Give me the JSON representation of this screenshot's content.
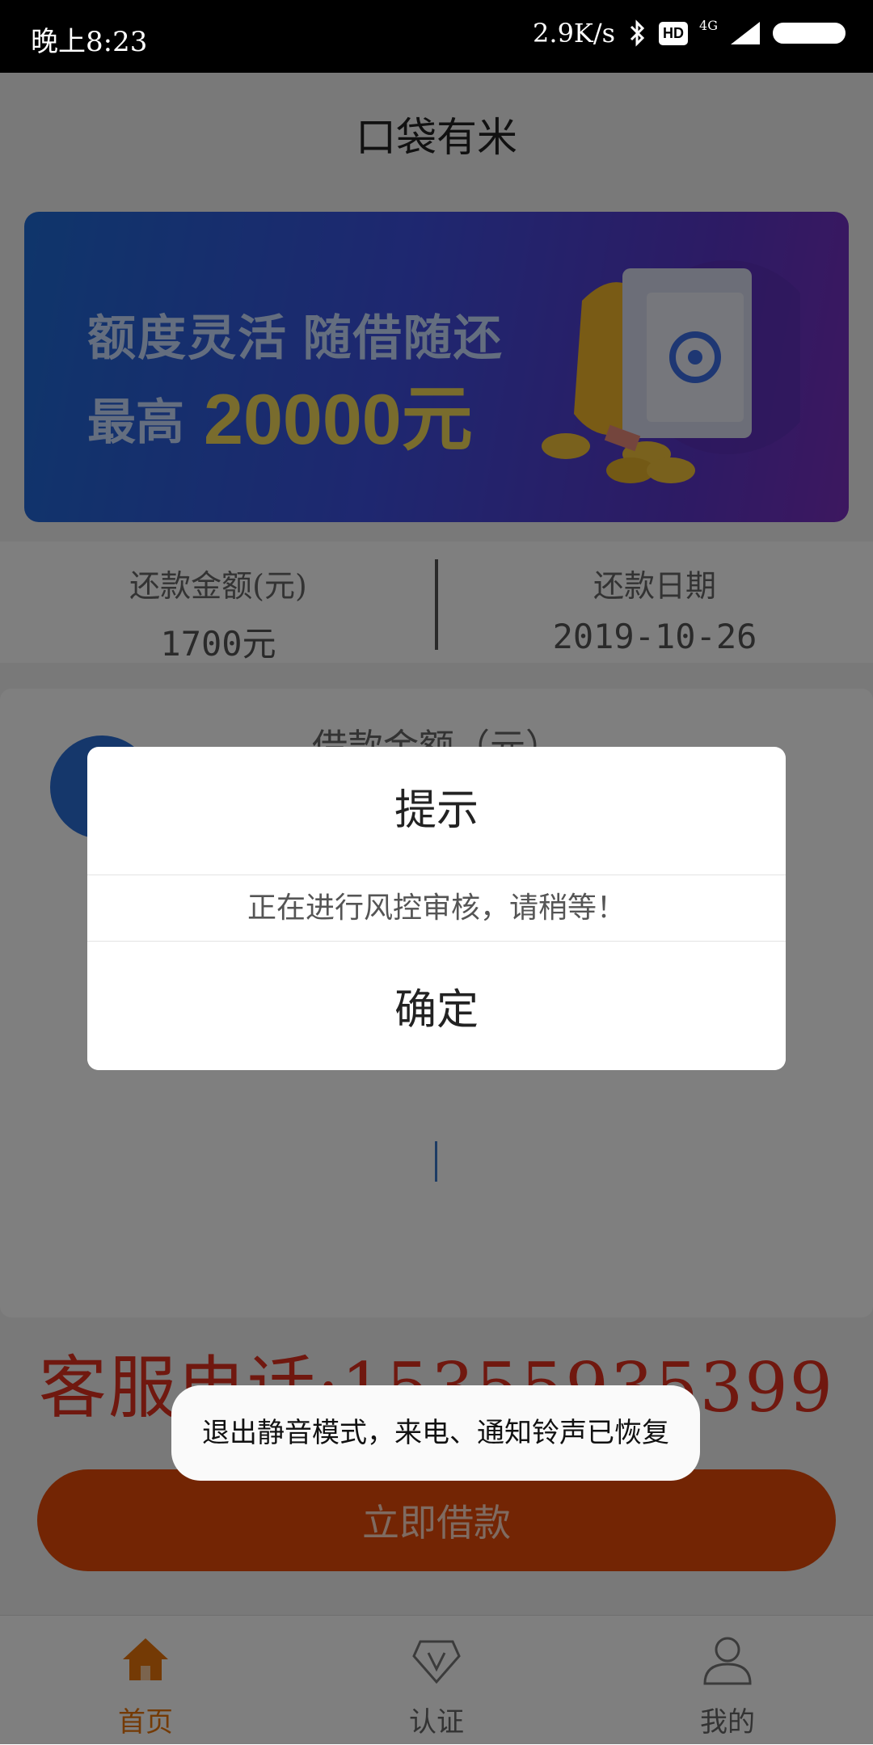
{
  "status_bar": {
    "time": "晚上8:23",
    "speed": "2.9K/s",
    "hd": "HD",
    "network": "4G",
    "icons": [
      "bluetooth-icon",
      "hd-icon",
      "signal-icon",
      "battery-icon"
    ]
  },
  "header": {
    "title": "口袋有米"
  },
  "banner": {
    "line1": "额度灵活 随借随还",
    "line2_prefix": "最高",
    "line2_amount": "20000元",
    "colors": {
      "gradient_start": "#1e6bd6",
      "gradient_end": "#7a2fc0",
      "amount": "#f3d95a"
    }
  },
  "repayment": {
    "amount_label": "还款金额(元)",
    "amount_value": "1700元",
    "date_label": "还款日期",
    "date_value": "2019-10-26"
  },
  "loan_card": {
    "title_partial": "借款金额（元）"
  },
  "hotline": {
    "text": "客服电话:15355935399"
  },
  "borrow_button": {
    "label": "立即借款",
    "color": "#e64a08"
  },
  "tabbar": {
    "items": [
      {
        "label": "首页",
        "icon": "home-icon",
        "active": true
      },
      {
        "label": "认证",
        "icon": "verify-diamond-icon",
        "active": false
      },
      {
        "label": "我的",
        "icon": "user-icon",
        "active": false
      }
    ],
    "active_color": "#e8750a"
  },
  "dialog": {
    "title": "提示",
    "message": "正在进行风控审核，请稍等！",
    "confirm_label": "确定"
  },
  "toast": {
    "text": "退出静音模式，来电、通知铃声已恢复"
  }
}
